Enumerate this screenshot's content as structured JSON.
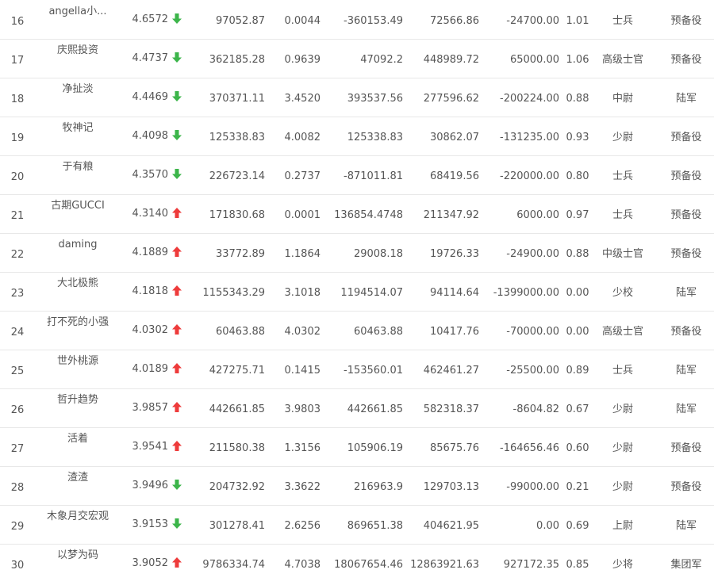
{
  "colors": {
    "up": "#ee3b3b",
    "down": "#3cb54a",
    "text": "#555555",
    "divider": "#e8e8e8"
  },
  "rows": [
    {
      "rank": "16",
      "name": "angella小...",
      "score": "4.6572",
      "trend": "down",
      "v1": "97052.87",
      "v2": "0.0044",
      "v3": "-360153.49",
      "v4": "72566.86",
      "v5": "-24700.00",
      "v6": "1.01",
      "rank_title": "士兵",
      "army": "预备役"
    },
    {
      "rank": "17",
      "name": "庆熙投资",
      "score": "4.4737",
      "trend": "down",
      "v1": "362185.28",
      "v2": "0.9639",
      "v3": "47092.2",
      "v4": "448989.72",
      "v5": "65000.00",
      "v6": "1.06",
      "rank_title": "高级士官",
      "army": "预备役"
    },
    {
      "rank": "18",
      "name": "净扯淡",
      "score": "4.4469",
      "trend": "down",
      "v1": "370371.11",
      "v2": "3.4520",
      "v3": "393537.56",
      "v4": "277596.62",
      "v5": "-200224.00",
      "v6": "0.88",
      "rank_title": "中尉",
      "army": "陆军"
    },
    {
      "rank": "19",
      "name": "牧神记",
      "score": "4.4098",
      "trend": "down",
      "v1": "125338.83",
      "v2": "4.0082",
      "v3": "125338.83",
      "v4": "30862.07",
      "v5": "-131235.00",
      "v6": "0.93",
      "rank_title": "少尉",
      "army": "预备役"
    },
    {
      "rank": "20",
      "name": "于有粮",
      "score": "4.3570",
      "trend": "down",
      "v1": "226723.14",
      "v2": "0.2737",
      "v3": "-871011.81",
      "v4": "68419.56",
      "v5": "-220000.00",
      "v6": "0.80",
      "rank_title": "士兵",
      "army": "预备役"
    },
    {
      "rank": "21",
      "name": "古期GUCCI",
      "score": "4.3140",
      "trend": "up",
      "v1": "171830.68",
      "v2": "0.0001",
      "v3": "136854.4748",
      "v4": "211347.92",
      "v5": "6000.00",
      "v6": "0.97",
      "rank_title": "士兵",
      "army": "预备役"
    },
    {
      "rank": "22",
      "name": "daming",
      "score": "4.1889",
      "trend": "up",
      "v1": "33772.89",
      "v2": "1.1864",
      "v3": "29008.18",
      "v4": "19726.33",
      "v5": "-24900.00",
      "v6": "0.88",
      "rank_title": "中级士官",
      "army": "预备役"
    },
    {
      "rank": "23",
      "name": "大北极熊",
      "score": "4.1818",
      "trend": "up",
      "v1": "1155343.29",
      "v2": "3.1018",
      "v3": "1194514.07",
      "v4": "94114.64",
      "v5": "-1399000.00",
      "v6": "0.00",
      "rank_title": "少校",
      "army": "陆军"
    },
    {
      "rank": "24",
      "name": "打不死的小强",
      "score": "4.0302",
      "trend": "up",
      "v1": "60463.88",
      "v2": "4.0302",
      "v3": "60463.88",
      "v4": "10417.76",
      "v5": "-70000.00",
      "v6": "0.00",
      "rank_title": "高级士官",
      "army": "预备役"
    },
    {
      "rank": "25",
      "name": "世外桃源",
      "score": "4.0189",
      "trend": "up",
      "v1": "427275.71",
      "v2": "0.1415",
      "v3": "-153560.01",
      "v4": "462461.27",
      "v5": "-25500.00",
      "v6": "0.89",
      "rank_title": "士兵",
      "army": "陆军"
    },
    {
      "rank": "26",
      "name": "哲升趋势",
      "score": "3.9857",
      "trend": "up",
      "v1": "442661.85",
      "v2": "3.9803",
      "v3": "442661.85",
      "v4": "582318.37",
      "v5": "-8604.82",
      "v6": "0.67",
      "rank_title": "少尉",
      "army": "陆军"
    },
    {
      "rank": "27",
      "name": "活着",
      "score": "3.9541",
      "trend": "up",
      "v1": "211580.38",
      "v2": "1.3156",
      "v3": "105906.19",
      "v4": "85675.76",
      "v5": "-164656.46",
      "v6": "0.60",
      "rank_title": "少尉",
      "army": "预备役"
    },
    {
      "rank": "28",
      "name": "渣渣",
      "score": "3.9496",
      "trend": "down",
      "v1": "204732.92",
      "v2": "3.3622",
      "v3": "216963.9",
      "v4": "129703.13",
      "v5": "-99000.00",
      "v6": "0.21",
      "rank_title": "少尉",
      "army": "预备役"
    },
    {
      "rank": "29",
      "name": "木象月交宏观",
      "score": "3.9153",
      "trend": "down",
      "v1": "301278.41",
      "v2": "2.6256",
      "v3": "869651.38",
      "v4": "404621.95",
      "v5": "0.00",
      "v6": "0.69",
      "rank_title": "上尉",
      "army": "陆军"
    },
    {
      "rank": "30",
      "name": "以梦为码",
      "score": "3.9052",
      "trend": "up",
      "v1": "9786334.74",
      "v2": "4.7038",
      "v3": "18067654.46",
      "v4": "12863921.63",
      "v5": "927172.35",
      "v6": "0.85",
      "rank_title": "少将",
      "army": "集团军"
    }
  ]
}
